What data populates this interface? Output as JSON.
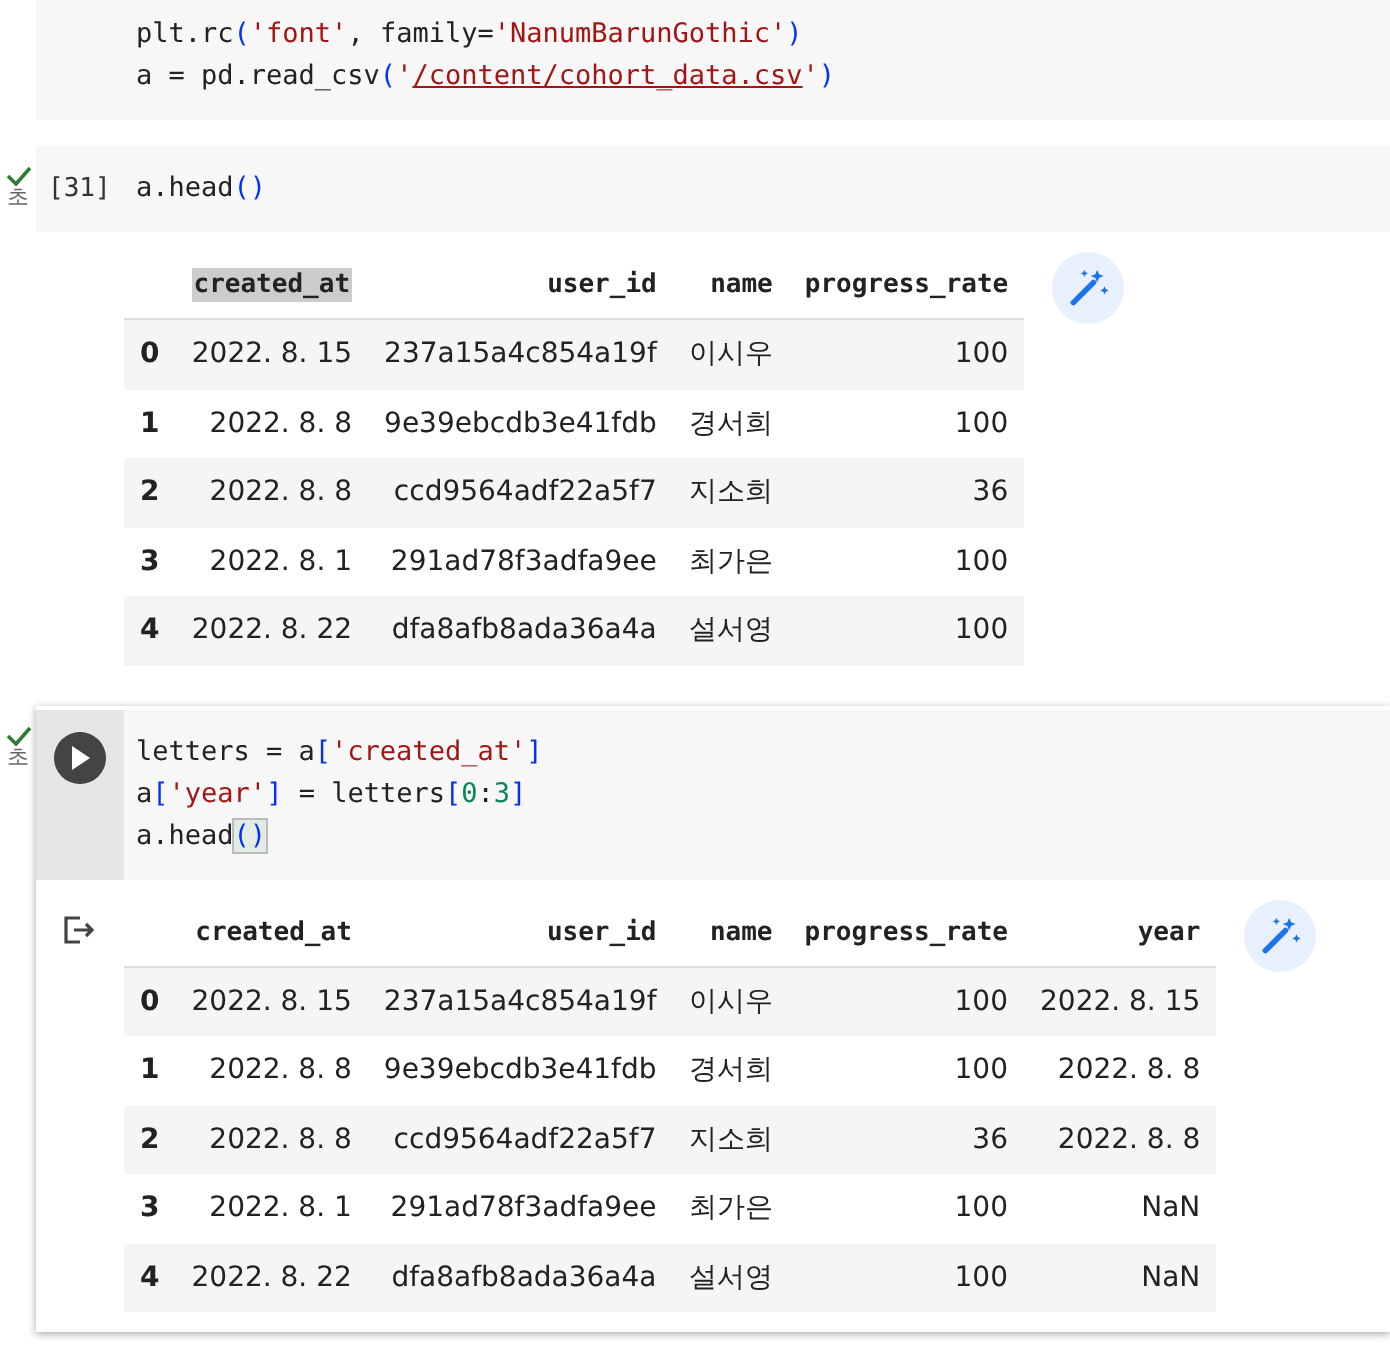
{
  "cells": [
    {
      "kind": "code",
      "focused": false,
      "lines": [
        [
          {
            "kind": "plain",
            "t": "plt.rc"
          },
          {
            "kind": "bracket",
            "t": "("
          },
          {
            "kind": "string",
            "t": "'font'"
          },
          {
            "kind": "plain",
            "t": ", family="
          },
          {
            "kind": "string",
            "t": "'NanumBarunGothic'"
          },
          {
            "kind": "bracket",
            "t": ")"
          }
        ],
        [
          {
            "kind": "plain",
            "t": "a = pd.read_csv"
          },
          {
            "kind": "bracket",
            "t": "("
          },
          {
            "kind": "string",
            "t": "'"
          },
          {
            "kind": "link",
            "t": "/content/cohort_data.csv"
          },
          {
            "kind": "string",
            "t": "'"
          },
          {
            "kind": "bracket",
            "t": ")"
          }
        ]
      ]
    },
    {
      "kind": "code",
      "focused": false,
      "prompt": "[31]",
      "succeeded": true,
      "elapsed": "초",
      "lines": [
        [
          {
            "kind": "plain",
            "t": "a.head"
          },
          {
            "kind": "bracket",
            "t": "()"
          }
        ]
      ],
      "output": {
        "table": {
          "columns": [
            {
              "label": "created_at",
              "highlighted": true
            },
            {
              "label": "user_id",
              "highlighted": false
            },
            {
              "label": "name",
              "highlighted": false
            },
            {
              "label": "progress_rate",
              "highlighted": false
            }
          ],
          "rows": [
            {
              "index": "0",
              "cells": [
                "2022. 8. 15",
                "237a15a4c854a19f",
                "이시우",
                "100"
              ]
            },
            {
              "index": "1",
              "cells": [
                "2022. 8. 8",
                "9e39ebcdb3e41fdb",
                "경서희",
                "100"
              ]
            },
            {
              "index": "2",
              "cells": [
                "2022. 8. 8",
                "ccd9564adf22a5f7",
                "지소희",
                "36"
              ]
            },
            {
              "index": "3",
              "cells": [
                "2022. 8. 1",
                "291ad78f3adfa9ee",
                "최가은",
                "100"
              ]
            },
            {
              "index": "4",
              "cells": [
                "2022. 8. 22",
                "dfa8afb8ada36a4a",
                "설서영",
                "100"
              ]
            }
          ]
        }
      }
    },
    {
      "kind": "code",
      "focused": true,
      "succeeded": true,
      "elapsed": "초",
      "lines": [
        [
          {
            "kind": "plain",
            "t": "letters = a"
          },
          {
            "kind": "bracket",
            "t": "["
          },
          {
            "kind": "string",
            "t": "'created_at'"
          },
          {
            "kind": "bracket",
            "t": "]"
          }
        ],
        [
          {
            "kind": "plain",
            "t": "a"
          },
          {
            "kind": "bracket",
            "t": "["
          },
          {
            "kind": "string",
            "t": "'year'"
          },
          {
            "kind": "bracket",
            "t": "]"
          },
          {
            "kind": "plain",
            "t": " = letters"
          },
          {
            "kind": "bracket",
            "t": "["
          },
          {
            "kind": "number",
            "t": "0"
          },
          {
            "kind": "plain",
            "t": ":"
          },
          {
            "kind": "number",
            "t": "3"
          },
          {
            "kind": "bracket",
            "t": "]"
          }
        ],
        [
          {
            "kind": "plain",
            "t": "a.head"
          },
          {
            "kind": "match",
            "t": "()"
          }
        ]
      ],
      "output": {
        "table": {
          "columns": [
            {
              "label": "created_at",
              "highlighted": false
            },
            {
              "label": "user_id",
              "highlighted": false
            },
            {
              "label": "name",
              "highlighted": false
            },
            {
              "label": "progress_rate",
              "highlighted": false
            },
            {
              "label": "year",
              "highlighted": false
            }
          ],
          "rows": [
            {
              "index": "0",
              "cells": [
                "2022. 8. 15",
                "237a15a4c854a19f",
                "이시우",
                "100",
                "2022. 8. 15"
              ]
            },
            {
              "index": "1",
              "cells": [
                "2022. 8. 8",
                "9e39ebcdb3e41fdb",
                "경서희",
                "100",
                "2022. 8. 8"
              ]
            },
            {
              "index": "2",
              "cells": [
                "2022. 8. 8",
                "ccd9564adf22a5f7",
                "지소희",
                "36",
                "2022. 8. 8"
              ]
            },
            {
              "index": "3",
              "cells": [
                "2022. 8. 1",
                "291ad78f3adfa9ee",
                "최가은",
                "100",
                "NaN"
              ]
            },
            {
              "index": "4",
              "cells": [
                "2022. 8. 22",
                "dfa8afb8ada36a4a",
                "설서영",
                "100",
                "NaN"
              ]
            }
          ]
        }
      }
    }
  ]
}
